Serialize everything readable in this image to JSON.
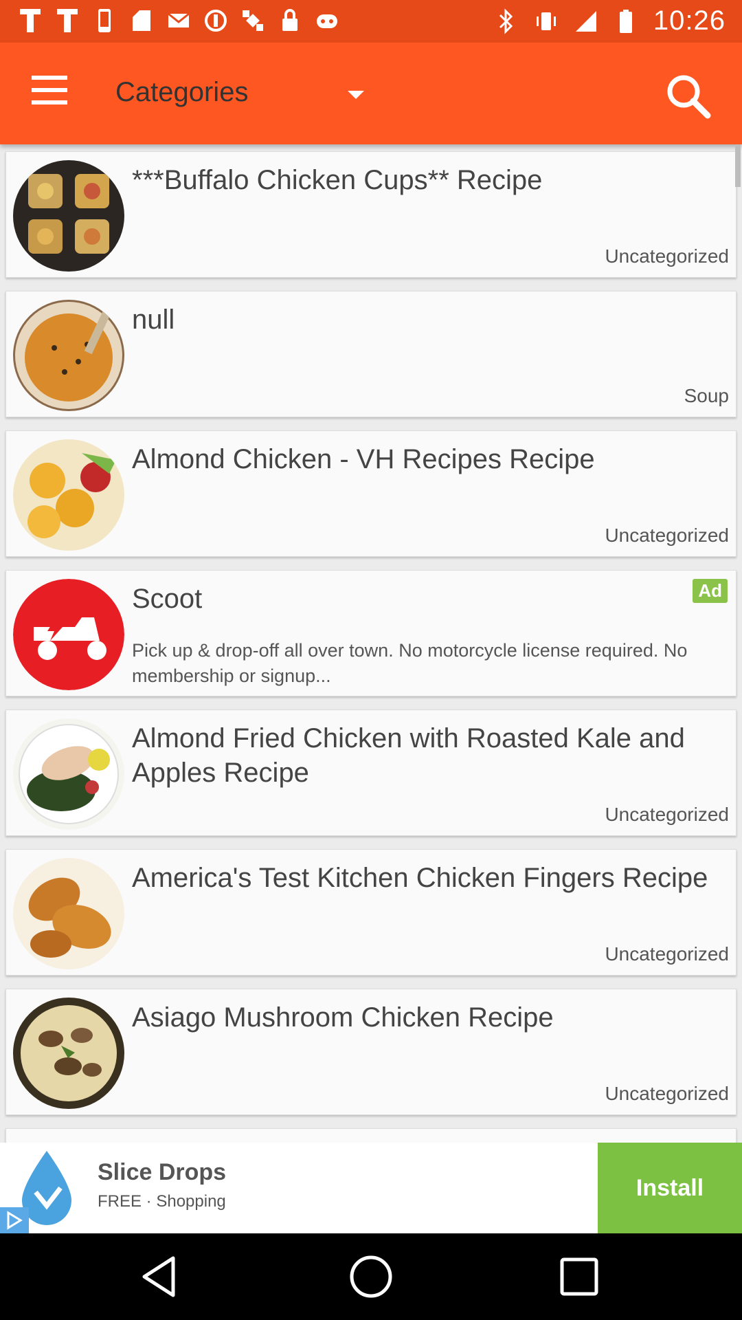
{
  "status_bar": {
    "time": "10:26",
    "left_icons": [
      "fake-gps-icon",
      "fake-gps-icon",
      "phone-icon",
      "tablet-icon",
      "mail-icon",
      "blocked-icon",
      "satellite-icon",
      "lock-icon",
      "game-icon"
    ],
    "right_icons": [
      "bluetooth-icon",
      "vibrate-icon",
      "signal-icon",
      "battery-icon"
    ]
  },
  "appbar": {
    "title": "Categories",
    "menu_icon": "hamburger-menu-icon",
    "dropdown_icon": "dropdown-arrow-icon",
    "search_icon": "search-icon",
    "color": "#ff5722"
  },
  "items": [
    {
      "title": "***Buffalo Chicken Cups** Recipe",
      "category": "Uncategorized",
      "thumb": "buffalo-chicken-cups"
    },
    {
      "title": "null",
      "category": "Soup",
      "thumb": "soup"
    },
    {
      "title": "Almond Chicken - VH Recipes Recipe",
      "category": "Uncategorized",
      "thumb": "almond-chicken"
    },
    {
      "title": "Scoot",
      "ad_badge": "Ad",
      "description": "Pick up & drop-off all over town. No motorcycle license required. No membership or signup...",
      "thumb": "scoot-logo"
    },
    {
      "title": "Almond Fried Chicken with Roasted Kale and Apples Recipe",
      "category": "Uncategorized",
      "thumb": "almond-fried-chicken"
    },
    {
      "title": "America's Test Kitchen Chicken Fingers Recipe",
      "category": "Uncategorized",
      "thumb": "chicken-fingers"
    },
    {
      "title": "Asiago Mushroom Chicken Recipe",
      "category": "Uncategorized",
      "thumb": "mushroom-chicken"
    }
  ],
  "bottom_ad": {
    "name": "Slice Drops",
    "subtitle": "FREE · Shopping",
    "install_label": "Install",
    "install_color": "#7cc142"
  },
  "nav_bar": {
    "buttons": [
      "back-icon",
      "home-icon",
      "recents-icon"
    ]
  }
}
